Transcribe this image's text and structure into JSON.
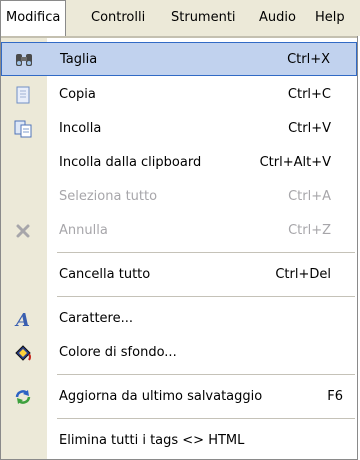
{
  "menubar": {
    "items": [
      {
        "label": "Modifica",
        "active": true
      },
      {
        "label": "Controlli"
      },
      {
        "label": "Strumenti"
      },
      {
        "label": "Audio"
      },
      {
        "label": "Help"
      }
    ]
  },
  "menu": {
    "items": [
      {
        "label": "Taglia",
        "shortcut": "Ctrl+X",
        "icon": "binoculars-cut-icon",
        "highlighted": true,
        "enabled": true
      },
      {
        "label": "Copia",
        "shortcut": "Ctrl+C",
        "icon": "copy-icon",
        "enabled": true
      },
      {
        "label": "Incolla",
        "shortcut": "Ctrl+V",
        "icon": "paste-icon",
        "enabled": true
      },
      {
        "label": "Incolla dalla clipboard",
        "shortcut": "Ctrl+Alt+V",
        "enabled": true
      },
      {
        "label": "Seleziona tutto",
        "shortcut": "Ctrl+A",
        "enabled": false
      },
      {
        "label": "Annulla",
        "shortcut": "Ctrl+Z",
        "icon": "undo-x-icon",
        "enabled": false
      },
      {
        "label": "Cancella tutto",
        "shortcut": "Ctrl+Del",
        "enabled": true
      },
      {
        "label": "Carattere...",
        "icon": "font-a-icon",
        "enabled": true
      },
      {
        "label": "Colore di sfondo...",
        "icon": "paint-bucket-icon",
        "enabled": true
      },
      {
        "label": "Aggiorna da ultimo salvataggio",
        "shortcut": "F6",
        "icon": "refresh-icon",
        "enabled": true
      },
      {
        "label": "Elimina tutti i tags <> HTML",
        "enabled": true
      }
    ]
  },
  "colors": {
    "highlight_fill": "#c1d2ee",
    "highlight_border": "#316ac5",
    "disabled_text": "#a7a6aa",
    "menubar_bg": "#ece9d8"
  }
}
